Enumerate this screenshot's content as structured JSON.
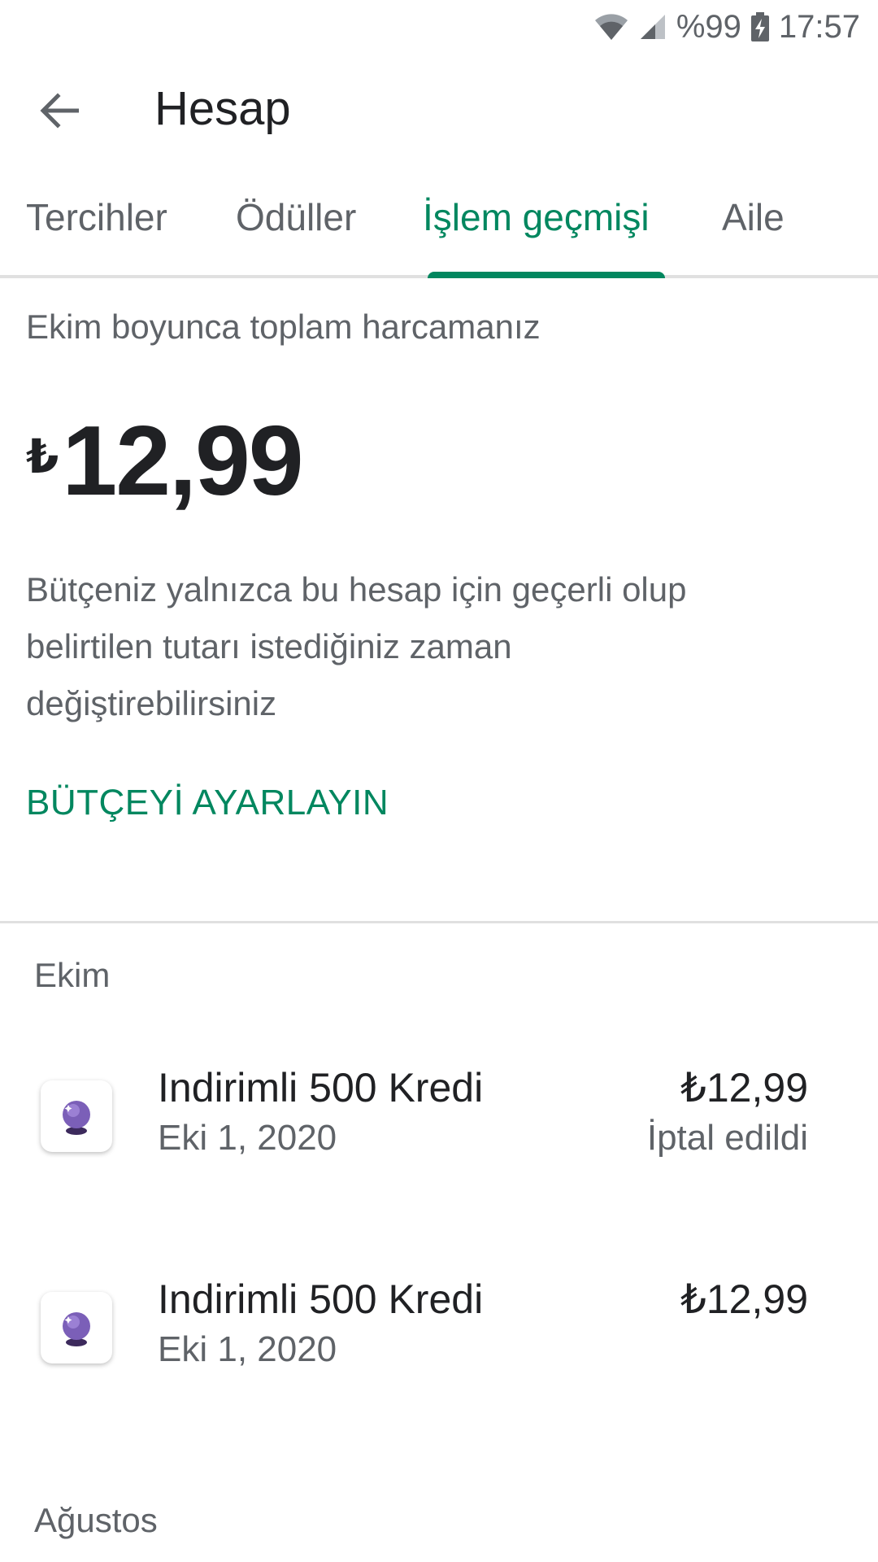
{
  "status_bar": {
    "battery_percent": "%99",
    "time": "17:57"
  },
  "app_bar": {
    "title": "Hesap",
    "back_icon": "arrow-back-icon"
  },
  "tabs": [
    {
      "label": "Tercihler",
      "active": false
    },
    {
      "label": "Ödüller",
      "active": false
    },
    {
      "label": "İşlem geçmişi",
      "active": true
    },
    {
      "label": "Aile",
      "active": false
    }
  ],
  "summary": {
    "label": "Ekim boyunca toplam harcamanız",
    "currency_symbol": "₺",
    "amount": "12,99",
    "description": "Bütçeniz yalnızca bu hesap için geçerli olup belirtilen tutarı istediğiniz zaman değiştirebilirsiniz",
    "budget_link": "BÜTÇEYİ AYARLAYIN"
  },
  "sections": [
    {
      "header": "Ekim",
      "transactions": [
        {
          "title": "Indirimli 500 Kredi",
          "date": "Eki 1, 2020",
          "price": "₺12,99",
          "status": "İptal edildi",
          "icon": "crystal-ball-icon"
        },
        {
          "title": "Indirimli 500 Kredi",
          "date": "Eki 1, 2020",
          "price": "₺12,99",
          "status": "",
          "icon": "crystal-ball-icon"
        }
      ]
    },
    {
      "header": "Ağustos",
      "transactions": []
    }
  ],
  "colors": {
    "accent": "#01875f",
    "text_primary": "#202124",
    "text_secondary": "#5f6368",
    "divider": "#e0e0e0"
  }
}
